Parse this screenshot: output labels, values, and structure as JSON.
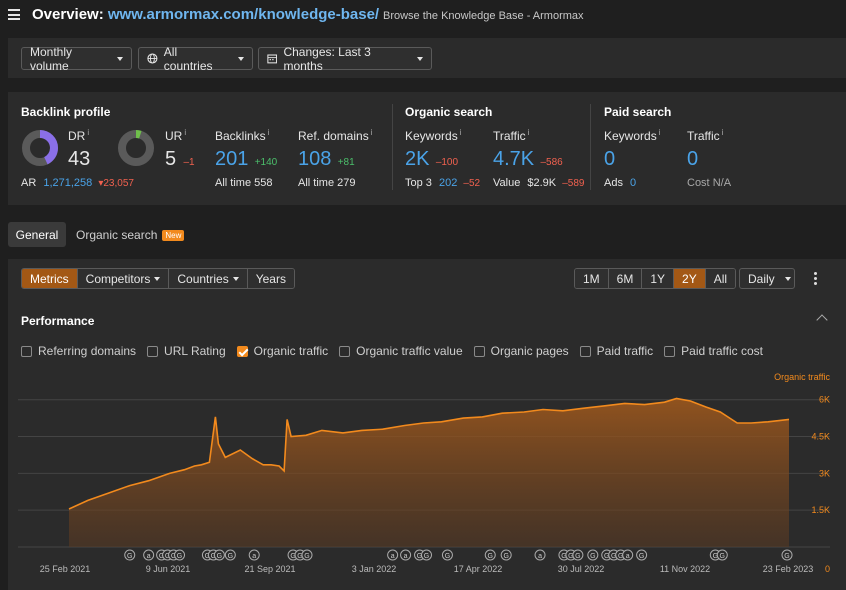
{
  "header": {
    "title_prefix": "Overview:",
    "url": "www.armormax.com/knowledge-base/",
    "subtitle": "Browse the Knowledge Base - Armormax"
  },
  "filters": {
    "volume": "Monthly volume",
    "countries": "All countries",
    "changes": "Changes: Last 3 months"
  },
  "backlink_profile": {
    "title": "Backlink profile",
    "dr_label": "DR",
    "dr_value": "43",
    "dr_fill": 0.43,
    "ur_label": "UR",
    "ur_value": "5",
    "ur_delta": "–1",
    "ur_fill": 0.05,
    "ar_label": "AR",
    "ar_value": "1,271,258",
    "ar_delta": "23,057",
    "backlinks_label": "Backlinks",
    "backlinks_value": "201",
    "backlinks_delta": "+140",
    "backlinks_alltime_label": "All time",
    "backlinks_alltime": "558",
    "refdomains_label": "Ref. domains",
    "refdomains_value": "108",
    "refdomains_delta": "+81",
    "refdomains_alltime_label": "All time",
    "refdomains_alltime": "279"
  },
  "organic_search": {
    "title": "Organic search",
    "keywords_label": "Keywords",
    "keywords_value": "2K",
    "keywords_delta": "–100",
    "top3_label": "Top 3",
    "top3_value": "202",
    "top3_delta": "–52",
    "traffic_label": "Traffic",
    "traffic_value": "4.7K",
    "traffic_delta": "–586",
    "value_label": "Value",
    "value_value": "$2.9K",
    "value_delta": "–589"
  },
  "paid_search": {
    "title": "Paid search",
    "keywords_label": "Keywords",
    "keywords_value": "0",
    "ads_label": "Ads",
    "ads_value": "0",
    "traffic_label": "Traffic",
    "traffic_value": "0",
    "cost_label": "Cost",
    "cost_value": "N/A"
  },
  "tabs": {
    "general": "General",
    "organic": "Organic search",
    "new_badge": "New"
  },
  "chart_toolbar": {
    "metrics": "Metrics",
    "competitors": "Competitors",
    "countries": "Countries",
    "years": "Years",
    "ranges": [
      "1M",
      "6M",
      "1Y",
      "2Y",
      "All"
    ],
    "active_range": "2Y",
    "granularity": "Daily"
  },
  "performance": {
    "title": "Performance",
    "checkboxes": [
      {
        "label": "Referring domains",
        "checked": false
      },
      {
        "label": "URL Rating",
        "checked": false
      },
      {
        "label": "Organic traffic",
        "checked": true
      },
      {
        "label": "Organic traffic value",
        "checked": false
      },
      {
        "label": "Organic pages",
        "checked": false
      },
      {
        "label": "Paid traffic",
        "checked": false
      },
      {
        "label": "Paid traffic cost",
        "checked": false
      }
    ]
  },
  "colors": {
    "accent": "#f28a1d",
    "link": "#4aa3e8",
    "positive": "#4bbf6b",
    "negative": "#f0614f",
    "dr_ring": "#8a6fe8",
    "ur_ring": "#6fbf4b"
  },
  "chart_data": {
    "type": "area",
    "series": [
      {
        "name": "Organic traffic",
        "x": [
          "2021-03-01",
          "2021-03-20",
          "2021-04-10",
          "2021-05-01",
          "2021-05-20",
          "2021-06-10",
          "2021-06-25",
          "2021-07-05",
          "2021-07-12",
          "2021-07-20",
          "2021-07-26",
          "2021-07-29",
          "2021-08-05",
          "2021-08-20",
          "2021-09-01",
          "2021-09-12",
          "2021-09-20",
          "2021-09-28",
          "2021-10-03",
          "2021-10-06",
          "2021-10-10",
          "2021-10-25",
          "2021-11-10",
          "2021-12-01",
          "2021-12-20",
          "2022-01-10",
          "2022-02-01",
          "2022-02-20",
          "2022-03-10",
          "2022-04-01",
          "2022-04-20",
          "2022-05-10",
          "2022-06-01",
          "2022-06-20",
          "2022-07-10",
          "2022-07-30",
          "2022-08-20",
          "2022-09-10",
          "2022-09-30",
          "2022-10-20",
          "2022-11-01",
          "2022-11-15",
          "2022-12-01",
          "2022-12-15",
          "2023-01-01",
          "2023-01-15",
          "2023-02-01",
          "2023-02-22"
        ],
        "values": [
          1550,
          1900,
          2200,
          2500,
          2700,
          3000,
          3150,
          3300,
          3350,
          3450,
          5300,
          4200,
          3650,
          3950,
          3600,
          3350,
          3350,
          3300,
          3100,
          5200,
          4500,
          4550,
          4750,
          4650,
          4750,
          4800,
          4950,
          5050,
          5100,
          5250,
          5300,
          5450,
          5500,
          5600,
          5550,
          5650,
          5750,
          5850,
          5800,
          5900,
          6050,
          5950,
          5700,
          5500,
          5050,
          5050,
          5100,
          5200
        ]
      }
    ],
    "y_ticks": [
      "1.5K",
      "3K",
      "4.5K",
      "6K"
    ],
    "y_zero": "0",
    "ylim": [
      0,
      6600
    ],
    "x_ticks": [
      "25 Feb 2021",
      "9 Jun 2021",
      "21 Sep 2021",
      "3 Jan 2022",
      "17 Apr 2022",
      "30 Jul 2022",
      "11 Nov 2022",
      "23 Feb 2023"
    ],
    "xlim": [
      "2021-02-25",
      "2023-02-23"
    ],
    "legend": "Organic traffic",
    "legend_position": "top-right",
    "grid": true,
    "annotation_markers": [
      {
        "date": "2021-05-01",
        "letter": "G"
      },
      {
        "date": "2021-05-20",
        "letter": "a"
      },
      {
        "date": "2021-06-02",
        "letter": "G"
      },
      {
        "date": "2021-06-08",
        "letter": "G"
      },
      {
        "date": "2021-06-14",
        "letter": "G"
      },
      {
        "date": "2021-06-20",
        "letter": "G"
      },
      {
        "date": "2021-07-18",
        "letter": "G"
      },
      {
        "date": "2021-07-24",
        "letter": "G"
      },
      {
        "date": "2021-07-30",
        "letter": "G"
      },
      {
        "date": "2021-08-10",
        "letter": "G"
      },
      {
        "date": "2021-09-03",
        "letter": "a"
      },
      {
        "date": "2021-10-12",
        "letter": "G"
      },
      {
        "date": "2021-10-19",
        "letter": "G"
      },
      {
        "date": "2021-10-26",
        "letter": "G"
      },
      {
        "date": "2022-01-20",
        "letter": "a"
      },
      {
        "date": "2022-02-02",
        "letter": "a"
      },
      {
        "date": "2022-02-16",
        "letter": "G"
      },
      {
        "date": "2022-02-23",
        "letter": "G"
      },
      {
        "date": "2022-03-16",
        "letter": "G"
      },
      {
        "date": "2022-04-28",
        "letter": "G"
      },
      {
        "date": "2022-05-14",
        "letter": "G"
      },
      {
        "date": "2022-06-17",
        "letter": "a"
      },
      {
        "date": "2022-07-11",
        "letter": "G"
      },
      {
        "date": "2022-07-18",
        "letter": "G"
      },
      {
        "date": "2022-07-25",
        "letter": "G"
      },
      {
        "date": "2022-08-09",
        "letter": "G"
      },
      {
        "date": "2022-08-23",
        "letter": "G"
      },
      {
        "date": "2022-08-30",
        "letter": "G"
      },
      {
        "date": "2022-09-06",
        "letter": "G"
      },
      {
        "date": "2022-09-13",
        "letter": "a"
      },
      {
        "date": "2022-09-27",
        "letter": "G"
      },
      {
        "date": "2022-12-10",
        "letter": "G"
      },
      {
        "date": "2022-12-17",
        "letter": "G"
      },
      {
        "date": "2023-02-20",
        "letter": "G"
      }
    ]
  }
}
